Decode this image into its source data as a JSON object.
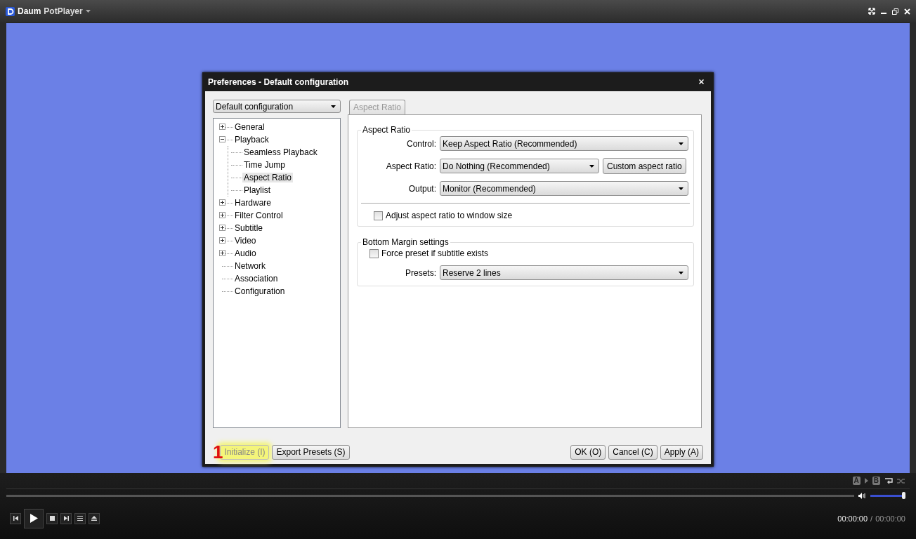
{
  "player": {
    "brand_primary": "Daum",
    "brand_secondary": "PotPlayer",
    "ab_repeat": {
      "a": "A",
      "b": "B"
    },
    "volume": {
      "level": 1
    },
    "time_current": "00:00:00",
    "time_separator": "/",
    "time_total": "00:00:00"
  },
  "dialog": {
    "title": "Preferences - Default configuration",
    "config_select": {
      "value": "Default configuration"
    },
    "tree": [
      {
        "label": "General",
        "kind": "group",
        "expanded": false,
        "selected": false
      },
      {
        "label": "Playback",
        "kind": "group",
        "expanded": true,
        "selected": false,
        "children": [
          {
            "label": "Seamless Playback",
            "kind": "leaf",
            "selected": false
          },
          {
            "label": "Time Jump",
            "kind": "leaf",
            "selected": false
          },
          {
            "label": "Aspect Ratio",
            "kind": "leaf",
            "selected": true
          },
          {
            "label": "Playlist",
            "kind": "leaf",
            "selected": false
          }
        ]
      },
      {
        "label": "Hardware",
        "kind": "group",
        "expanded": false,
        "selected": false
      },
      {
        "label": "Filter Control",
        "kind": "group",
        "expanded": false,
        "selected": false
      },
      {
        "label": "Subtitle",
        "kind": "group",
        "expanded": false,
        "selected": false
      },
      {
        "label": "Video",
        "kind": "group",
        "expanded": false,
        "selected": false
      },
      {
        "label": "Audio",
        "kind": "group",
        "expanded": false,
        "selected": false
      },
      {
        "label": "Network",
        "kind": "leaf",
        "selected": false
      },
      {
        "label": "Association",
        "kind": "leaf",
        "selected": false
      },
      {
        "label": "Configuration",
        "kind": "leaf",
        "selected": false
      }
    ],
    "tabs": [
      {
        "label": "Aspect Ratio",
        "selected": true
      }
    ],
    "groups": [
      {
        "title": "Aspect Ratio",
        "rows": [
          {
            "kind": "select",
            "label": "Control:",
            "value": "Keep Aspect Ratio (Recommended)"
          },
          {
            "kind": "select",
            "label": "Aspect Ratio:",
            "value": "Do Nothing (Recommended)",
            "button": "Custom aspect ratio"
          },
          {
            "kind": "select",
            "label": "Output:",
            "value": "Monitor (Recommended)"
          },
          {
            "kind": "divider"
          },
          {
            "kind": "checkbox",
            "label": "Adjust aspect ratio to window size",
            "checked": false
          }
        ]
      },
      {
        "title": "Bottom Margin settings",
        "rows": [
          {
            "kind": "checkbox",
            "label": "Force preset if subtitle exists",
            "checked": false
          },
          {
            "kind": "select",
            "label": "Presets:",
            "value": "Reserve 2 lines"
          }
        ]
      }
    ],
    "annotation": "1",
    "footer_left": [
      {
        "label": "Initialize (I)",
        "disabled": true,
        "highlighted": true
      },
      {
        "label": "Export Presets (S)",
        "disabled": false,
        "highlighted": false
      }
    ],
    "footer_right": [
      {
        "label": "OK (O)",
        "disabled": false,
        "highlighted": false
      },
      {
        "label": "Cancel (C)",
        "disabled": false,
        "highlighted": false
      },
      {
        "label": "Apply (A)",
        "disabled": false,
        "highlighted": false
      }
    ]
  }
}
